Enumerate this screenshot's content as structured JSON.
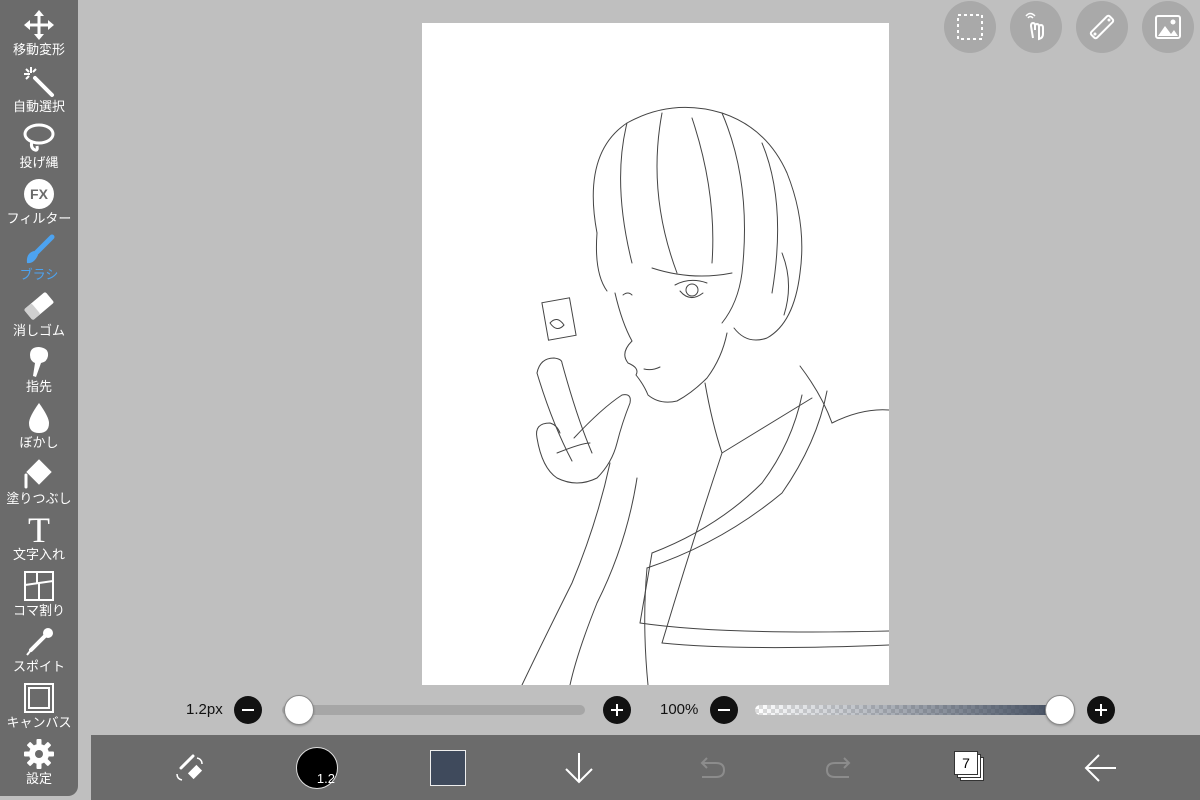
{
  "tools": [
    {
      "id": "move",
      "label": "移動変形"
    },
    {
      "id": "magic-wand",
      "label": "自動選択"
    },
    {
      "id": "lasso",
      "label": "投げ縄"
    },
    {
      "id": "filter",
      "label": "フィルター",
      "icon_text": "FX"
    },
    {
      "id": "brush",
      "label": "ブラシ",
      "active": true
    },
    {
      "id": "eraser",
      "label": "消しゴム"
    },
    {
      "id": "finger",
      "label": "指先"
    },
    {
      "id": "blur",
      "label": "ぼかし"
    },
    {
      "id": "fill",
      "label": "塗りつぶし"
    },
    {
      "id": "text",
      "label": "文字入れ",
      "icon_text": "T"
    },
    {
      "id": "frame",
      "label": "コマ割り"
    },
    {
      "id": "eyedropper",
      "label": "スポイト"
    },
    {
      "id": "canvas",
      "label": "キャンバス"
    },
    {
      "id": "settings",
      "label": "設定"
    }
  ],
  "top_buttons": [
    "selection-icon",
    "touch-icon",
    "ruler-icon",
    "material-icon"
  ],
  "brush_size": {
    "label": "1.2px",
    "value": 1.2,
    "min": 0,
    "max": 100
  },
  "opacity": {
    "label": "100%",
    "value": 100
  },
  "bottom": {
    "brush_size_badge": "1.2",
    "color_swatch": "#3f4a5c",
    "layers_count": "7"
  },
  "colors": {
    "accent": "#4da3f0",
    "toolbar": "#6b6b6b",
    "background": "#bfbfbf"
  }
}
